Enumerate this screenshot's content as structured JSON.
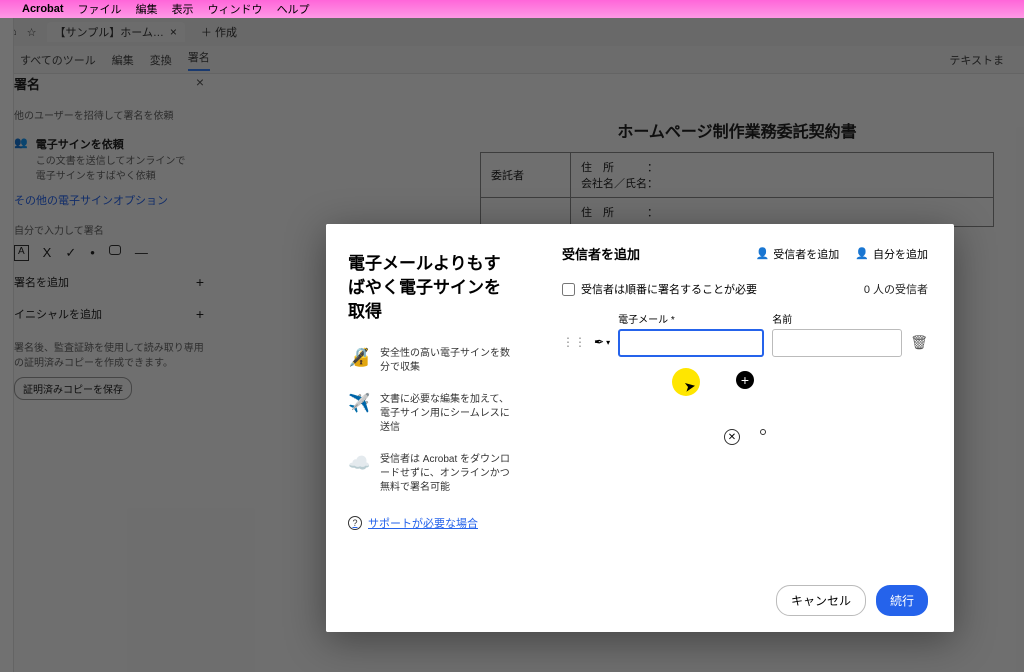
{
  "menubar": {
    "app": "Acrobat",
    "items": [
      "ファイル",
      "編集",
      "表示",
      "ウィンドウ",
      "ヘルプ"
    ]
  },
  "tabbar": {
    "tab_title": "【サンプル】ホーム…",
    "new_tab": "作成"
  },
  "toolbar": {
    "all_tools": "すべてのツール",
    "edit": "編集",
    "convert": "変換",
    "sign": "署名",
    "right": "テキストま"
  },
  "panel": {
    "title": "署名",
    "invite": "他のユーザーを招待して署名を依頼",
    "req_title": "電子サインを依頼",
    "req_sub1": "この文書を送信してオンラインで",
    "req_sub2": "電子サインをすばやく依頼",
    "other_link": "その他の電子サインオプション",
    "self_label": "自分で入力して署名",
    "add_sig": "署名を追加",
    "add_init": "イニシャルを追加",
    "note1": "署名後、監査証跡を使用して読み取り専用",
    "note2": "の証明済みコピーを作成できます。",
    "save_btn": "証明済みコピーを保存"
  },
  "doc": {
    "title": "ホームページ制作業務委託契約書",
    "r1c1": "委託者",
    "r1c2a": "住　所　　　：",
    "r1c2b": "会社名／氏名：",
    "r2c2a": "住　所　　　："
  },
  "modal": {
    "left_title": "電子メールよりもすばやく電子サインを取得",
    "f1": "安全性の高い電子サインを数分で収集",
    "f2": "文書に必要な編集を加えて、電子サイン用にシームレスに送信",
    "f3": "受信者は Acrobat をダウンロードせずに、オンラインかつ無料で署名可能",
    "help": "サポートが必要な場合",
    "right_title": "受信者を追加",
    "add_recipient": "受信者を追加",
    "add_self": "自分を追加",
    "order_label": "受信者は順番に署名することが必要",
    "count": "0 人の受信者",
    "email_label": "電子メール *",
    "name_label": "名前",
    "cancel": "キャンセル",
    "continue": "続行"
  }
}
